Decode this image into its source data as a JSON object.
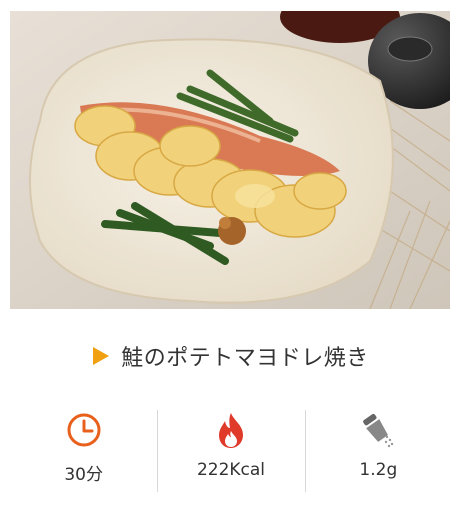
{
  "recipe": {
    "title": "鮭のポテトマヨドレ焼き",
    "photo_alt": "鮭のポテトマヨドレ焼きの料理写真"
  },
  "stats": {
    "time": {
      "icon": "clock-icon",
      "value": "30分"
    },
    "calories": {
      "icon": "flame-icon",
      "value": "222Kcal"
    },
    "salt": {
      "icon": "salt-shaker-icon",
      "value": "1.2g"
    }
  },
  "colors": {
    "accent": "#f0a010",
    "icon_orange": "#e8601c",
    "flame_red": "#e03a2a",
    "divider": "#d8d8d8",
    "text": "#333333"
  }
}
